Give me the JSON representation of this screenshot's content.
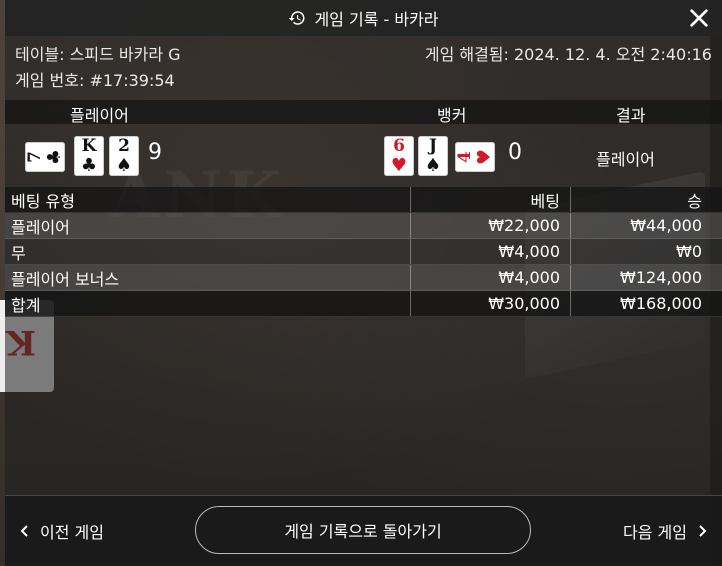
{
  "dialog": {
    "title": "게임 기록 - 바카라",
    "icon": "history-icon"
  },
  "info": {
    "table": "테이블: 스피드 바카라 G",
    "game_number": "게임 번호: #17:39:54",
    "resolved": "게임 해결됨: 2024. 12. 4. 오전 2:40:16"
  },
  "results": {
    "headers": {
      "player": "플레이어",
      "banker": "뱅커",
      "result": "결과"
    },
    "player_cards": [
      {
        "rank": "7",
        "suit": "♣"
      },
      {
        "rank": "K",
        "suit": "♣"
      },
      {
        "rank": "2",
        "suit": "♠"
      }
    ],
    "player_score": "9",
    "banker_cards": [
      {
        "rank": "6",
        "suit": "♥"
      },
      {
        "rank": "J",
        "suit": "♠"
      },
      {
        "rank": "4",
        "suit": "♥"
      }
    ],
    "banker_score": "0",
    "outcome": "플레이어"
  },
  "bets": {
    "headers": {
      "type": "베팅 유형",
      "bet": "베팅",
      "win": "승"
    },
    "rows": [
      {
        "type": "플레이어",
        "bet": "₩22,000",
        "win": "₩44,000"
      },
      {
        "type": "무",
        "bet": "₩4,000",
        "win": "₩0"
      },
      {
        "type": "플레이어 보너스",
        "bet": "₩4,000",
        "win": "₩124,000"
      }
    ],
    "total": {
      "type": "합계",
      "bet": "₩30,000",
      "win": "₩168,000"
    }
  },
  "footer": {
    "prev": "이전 게임",
    "back": "게임 기록으로 돌아가기",
    "next": "다음 게임"
  },
  "colors": {
    "red_suit": "#d11a2a",
    "black_suit": "#111111"
  }
}
